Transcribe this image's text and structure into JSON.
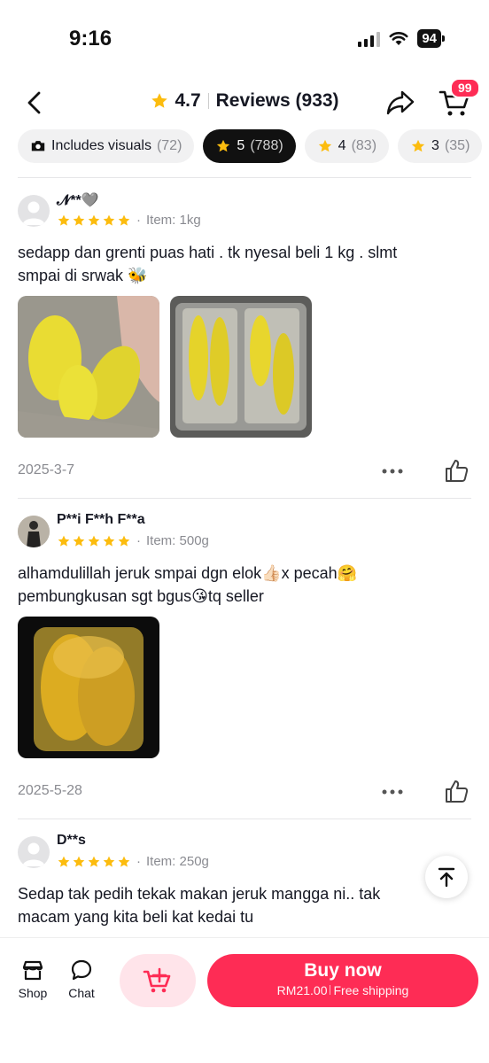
{
  "status_bar": {
    "time": "9:16",
    "battery": "94"
  },
  "header": {
    "rating": "4.7",
    "title": "Reviews (933)",
    "cart_badge": "99"
  },
  "filters": [
    {
      "icon": "camera-icon",
      "label": "Includes visuals",
      "count": "(72)",
      "active": false
    },
    {
      "icon": "star-icon",
      "label": "5",
      "count": "(788)",
      "active": true
    },
    {
      "icon": "star-icon",
      "label": "4",
      "count": "(83)",
      "active": false
    },
    {
      "icon": "star-icon",
      "label": "3",
      "count": "(35)",
      "active": false
    }
  ],
  "reviews": [
    {
      "name": "𝓝**🩶",
      "rating": 5,
      "item": "Item: 1kg",
      "text_line1": "sedapp dan grenti puas hati . tk nyesal beli 1 kg . slmt",
      "text_line2": "smpai di srwak 🐝",
      "date": "2025-3-7"
    },
    {
      "name": "P**i F**h F**a",
      "rating": 5,
      "item": "Item: 500g",
      "text_line1": "alhamdulillah jeruk smpai dgn elok👍🏻x pecah🤗",
      "text_line2": "pembungkusan sgt bgus😘tq seller",
      "date": "2025-5-28"
    },
    {
      "name": "D**s",
      "rating": 5,
      "item": "Item: 250g",
      "text_line1": "Sedap tak pedih tekak makan jeruk mangga ni.. tak",
      "text_line2": "macam yang kita beli kat kedai tu"
    }
  ],
  "bottom_bar": {
    "shop_label": "Shop",
    "chat_label": "Chat",
    "buy_label": "Buy now",
    "price": "RM21.00",
    "shipping": "Free shipping"
  },
  "colors": {
    "accent": "#fe2c55",
    "star": "#fcbc0e",
    "muted": "#8a8b91"
  }
}
